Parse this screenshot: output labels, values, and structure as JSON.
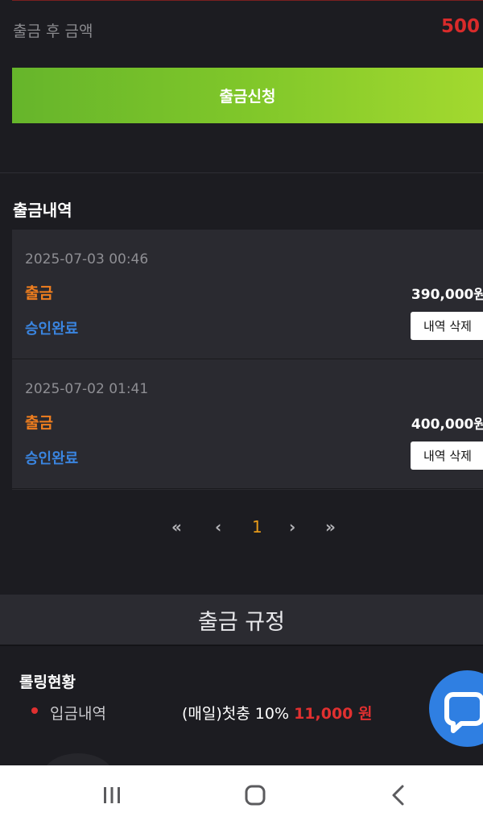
{
  "withdraw": {
    "after_label": "출금 후 금액",
    "after_value": "500",
    "apply_button": "출금신청"
  },
  "history": {
    "title": "출금내역",
    "records": [
      {
        "date": "2025-07-03 00:46",
        "type": "출금",
        "amount": "390,000원",
        "status": "승인완료",
        "delete_label": "내역 삭제"
      },
      {
        "date": "2025-07-02 01:41",
        "type": "출금",
        "amount": "400,000원",
        "status": "승인완료",
        "delete_label": "내역 삭제"
      }
    ]
  },
  "pagination": {
    "first": "«",
    "prev": "‹",
    "current": "1",
    "next": "›",
    "last": "»"
  },
  "rules": {
    "title": "출금 규정",
    "rolling_title": "롤링현황",
    "deposit_label": "입금내역",
    "rule_text": "(매일)첫충 10%",
    "rule_amount": "11,000 원"
  },
  "icons": {
    "chat": "chat-bubble-icon",
    "nav_recent": "recent-apps-icon",
    "nav_home": "home-icon",
    "nav_back": "back-icon"
  },
  "colors": {
    "background": "#1c1c21",
    "accent_green": "#80c72a",
    "type_orange": "#f07e1e",
    "status_blue": "#3a85e0",
    "amount_red": "#d92b2b"
  }
}
